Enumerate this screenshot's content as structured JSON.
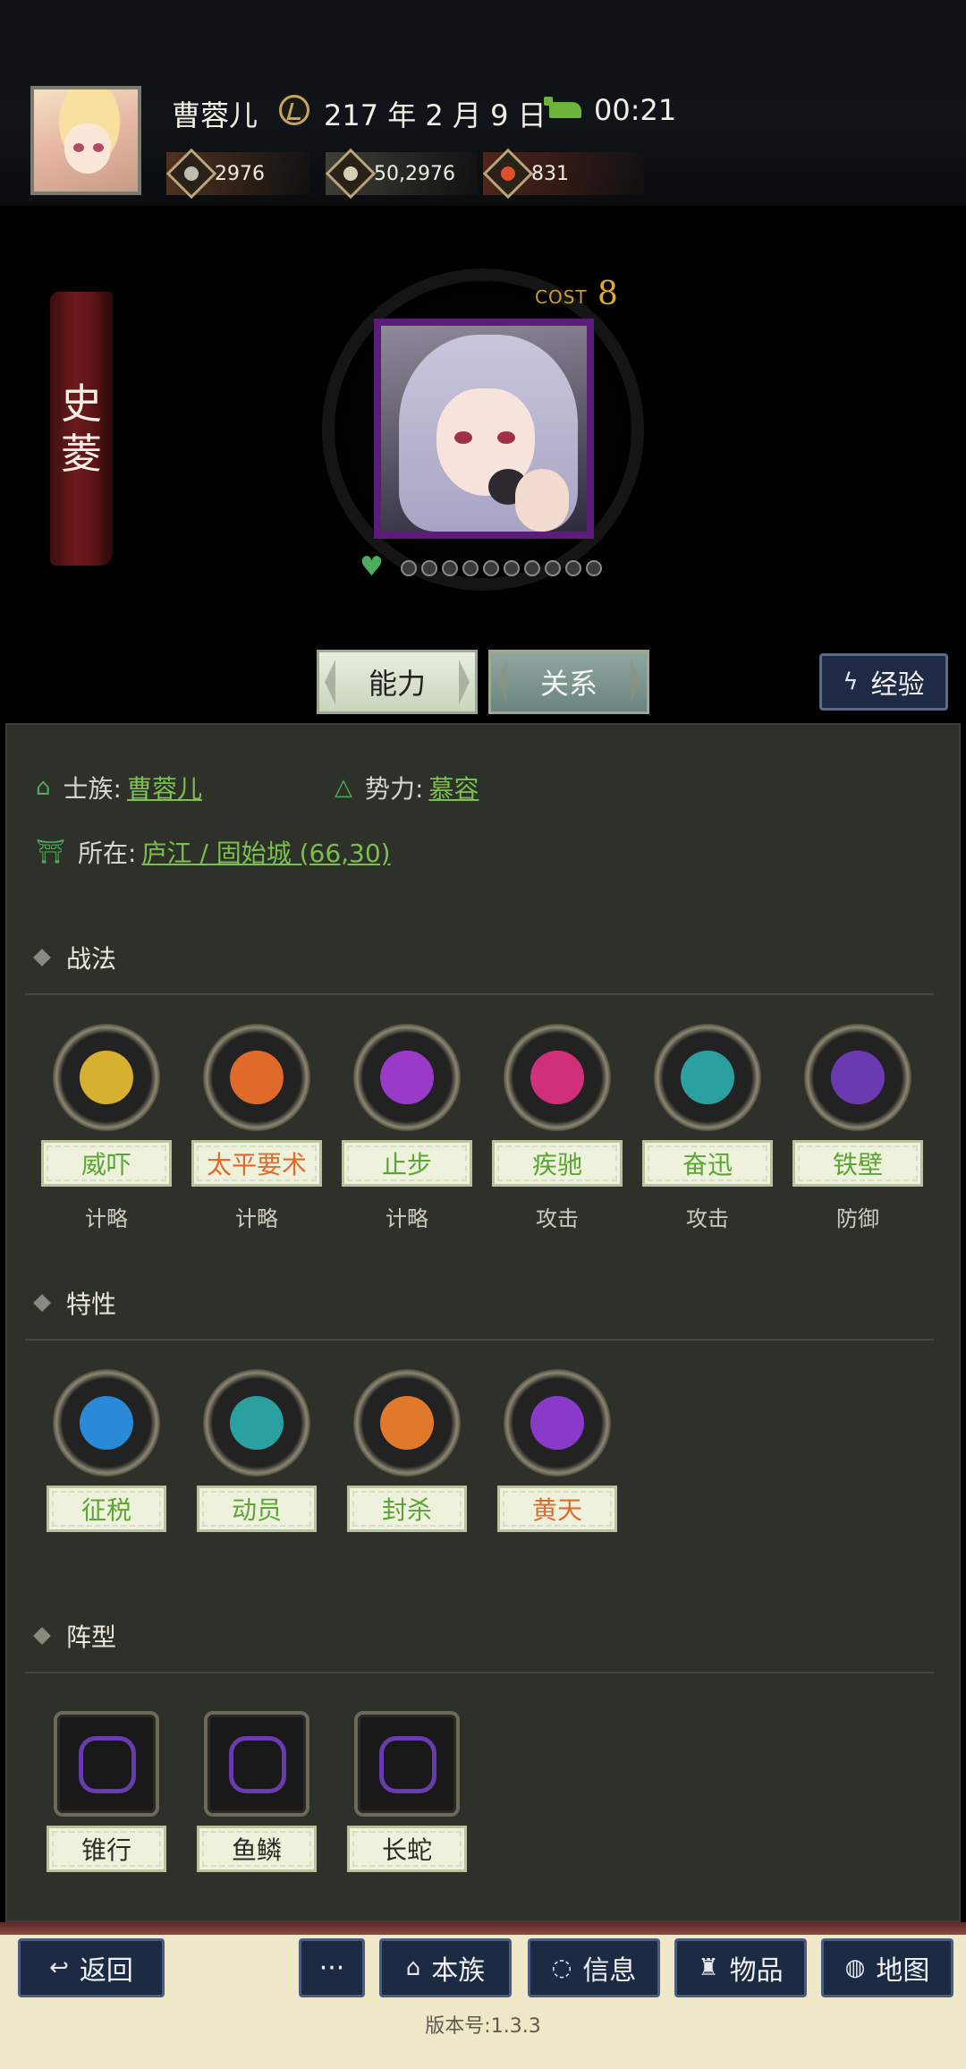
{
  "header": {
    "player_name": "曹蓉儿",
    "date": "217 年 2 月 9 日",
    "time": "00:21",
    "resources": [
      {
        "icon": "silver-coin-icon",
        "value": "2976"
      },
      {
        "icon": "grain-icon",
        "value": "50,2976"
      },
      {
        "icon": "fire-gem-icon",
        "value": "831"
      }
    ]
  },
  "character": {
    "name_chars": [
      "史",
      "菱"
    ],
    "cost_label": "COST",
    "cost_value": "8",
    "loyalty_dots": 10
  },
  "tabs": {
    "ability": "能力",
    "relation": "关系",
    "experience": "经验"
  },
  "info": {
    "clan_label": "士族:",
    "clan_value": "曹蓉儿",
    "faction_label": "势力:",
    "faction_value": "慕容",
    "location_label": "所在:",
    "location_value": "庐江 / 固始城 (66,30)"
  },
  "sections": {
    "tactics": "战法",
    "traits": "特性",
    "formations": "阵型"
  },
  "tactics": [
    {
      "name": "威吓",
      "kind": "计略",
      "color": "green",
      "sym": "#d8b030"
    },
    {
      "name": "太平要术",
      "kind": "计略",
      "color": "orange",
      "sym": "#e06a2a"
    },
    {
      "name": "止步",
      "kind": "计略",
      "color": "green",
      "sym": "#9a3ac8"
    },
    {
      "name": "疾驰",
      "kind": "攻击",
      "color": "green",
      "sym": "#d0307a"
    },
    {
      "name": "奋迅",
      "kind": "攻击",
      "color": "green",
      "sym": "#2aa0a0"
    },
    {
      "name": "铁壁",
      "kind": "防御",
      "color": "green",
      "sym": "#6a3ab0"
    }
  ],
  "traits": [
    {
      "name": "征税",
      "color": "green",
      "sym": "#2a8ad8"
    },
    {
      "name": "动员",
      "color": "green",
      "sym": "#2aa0a0"
    },
    {
      "name": "封杀",
      "color": "green",
      "sym": "#e07a2a"
    },
    {
      "name": "黄天",
      "color": "orange",
      "sym": "#8a3ac8"
    }
  ],
  "formations": [
    {
      "name": "锥行",
      "sym": "#6a3ab0"
    },
    {
      "name": "鱼鳞",
      "sym": "#6a3ab0"
    },
    {
      "name": "长蛇",
      "sym": "#6a3ab0"
    }
  ],
  "bottom_nav": {
    "back": "返回",
    "more": "···",
    "clan": "本族",
    "info": "信息",
    "items": "物品",
    "map": "地图",
    "version": "版本号:1.3.3"
  }
}
